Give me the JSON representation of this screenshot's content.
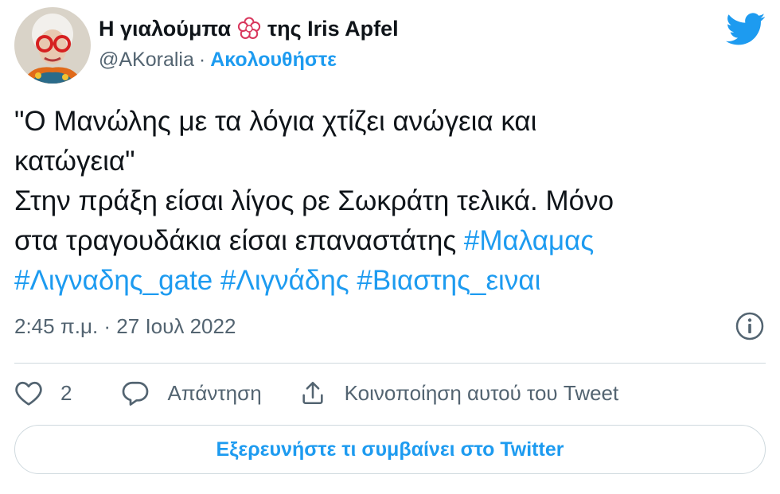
{
  "author": {
    "display_name_part1": "Η γιαλούμπα",
    "display_name_part2": "της Iris Apfel",
    "handle": "@AKoralia",
    "separator": "·",
    "follow_label": "Ακολουθήστε"
  },
  "tweet": {
    "lines": [
      "\"Ο Μανώλης με τα λόγια χτίζει ανώγεια και",
      "κατώγεια\"",
      "Στην πράξη είσαι λίγος ρε Σωκράτη τελικά. Μόνο",
      "στα τραγουδάκια είσαι επαναστάτης "
    ],
    "hashtags": [
      "#Μαλαμας",
      "#Λιγναδης_gate",
      "#Λιγνάδης",
      "#Βιαστης_ειναι"
    ],
    "timestamp": "2:45 π.μ. · 27 Ιουλ 2022"
  },
  "actions": {
    "like_count": "2",
    "reply_label": "Απάντηση",
    "share_label": "Κοινοποίηση αυτού του Tweet"
  },
  "explore_label": "Εξερευνήστε τι συμβαίνει στο Twitter",
  "colors": {
    "accent": "#1d9bf0",
    "text": "#0f1419",
    "secondary": "#536471",
    "border": "#cfd9de"
  },
  "icons": [
    "avatar",
    "flower-icon",
    "twitter-bird-icon",
    "info-icon",
    "heart-icon",
    "reply-bubble-icon",
    "share-icon"
  ]
}
